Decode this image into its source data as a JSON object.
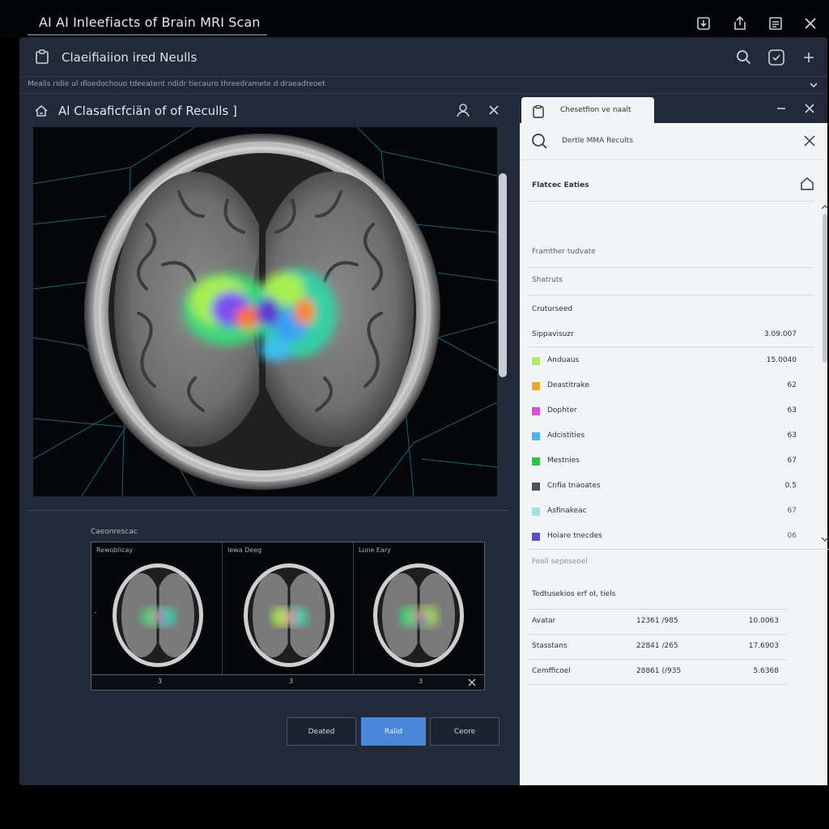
{
  "app": {
    "window_title": "AI AI Inleefiacts of Brain MRI Scan",
    "toolbar_title": "Claeifiaiion ired Neulls",
    "path_text": "Mealis ridie ul dloedochouo tdeeatent ndidr tiecauro threedramete d draeadteoet",
    "accent_color": "#4a87d8"
  },
  "left_panel": {
    "title": "Al Clasaficfciän of of Reculls ]",
    "compare_label": "Caeonrescac",
    "thumbnails": [
      {
        "label": "Rewoblicay",
        "index": "3"
      },
      {
        "label": "lewa Deeg",
        "index": "3"
      },
      {
        "label": "Lune Eary",
        "index": "3"
      }
    ],
    "side_mark": "-",
    "buttons": {
      "left": "Deated",
      "primary": "Ralid",
      "right": "Ceore"
    }
  },
  "right_panel": {
    "tab_label": "Chesetfion ve naalt",
    "search_text": "Dertle MMA Recults",
    "section_title": "Flatcec Eaties",
    "rows": [
      "Framther tudvate",
      "Shatruts",
      "Cruturseed"
    ],
    "summary": {
      "label": "Sippavisuzr",
      "value": "3.09.007"
    },
    "legend": [
      {
        "label": "Anduaus",
        "value": "15.0040",
        "color": "#b8e86a"
      },
      {
        "label": "Deastitrake",
        "value": "62",
        "color": "#f2a530"
      },
      {
        "label": "Dophter",
        "value": "63",
        "color": "#d44fd6"
      },
      {
        "label": "Adcistities",
        "value": "63",
        "color": "#47b6ea"
      },
      {
        "label": "Mestnies",
        "value": "67",
        "color": "#2ec44a"
      },
      {
        "label": "Cnfia tnaoates",
        "value": "0.5",
        "color": "#4a5060"
      },
      {
        "label": "Asfinakeac",
        "value": "67",
        "color": "#a8dde6"
      },
      {
        "label": "Hoiare tnecdes",
        "value": "06",
        "color": "#5b4fc8"
      }
    ],
    "footer_hint": "Feoll sepeseoel",
    "table_title": "Tedtusekios erf oI, tiels",
    "table_rows": [
      {
        "name": "Avatar",
        "mid": "12361 /985",
        "val": "10.0063"
      },
      {
        "name": "Stasstans",
        "mid": "22841 /265",
        "val": "17.6903"
      },
      {
        "name": "Cemfficoel",
        "mid": "28861 (/935",
        "val": "5.6368"
      }
    ]
  }
}
